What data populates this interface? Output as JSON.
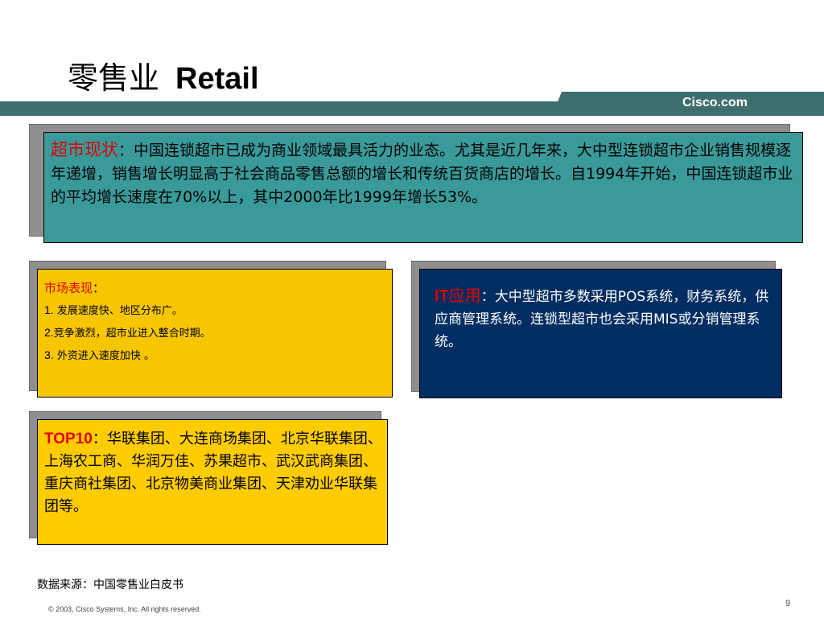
{
  "slide": {
    "title_cn": "零售业",
    "title_en": "Retail",
    "brand": "Cisco.com",
    "page_number": "9",
    "copyright": "© 2003, Cisco Systems, Inc. All rights reserved.",
    "source_note": "数据来源：中国零售业白皮书"
  },
  "box_status": {
    "label": "超市现状",
    "colon": "：",
    "text": "中国连锁超市已成为商业领域最具活力的业态。尤其是近几年来，大中型连锁超市企业销售规模逐年递增，销售增长明显高于社会商品零售总额的增长和传统百货商店的增长。自1994年开始，中国连锁超市业的平均增长速度在70%以上，其中2000年比1999年增长53%。"
  },
  "box_market": {
    "label": "市场表现",
    "colon": "：",
    "items": [
      {
        "num": "1.",
        "text": "发展速度快、地区分布广。"
      },
      {
        "num": "2.",
        "text": "竞争激烈，超市业进入整合时期。"
      },
      {
        "num": "3.",
        "text": "外资进入速度加快 。"
      }
    ]
  },
  "box_it": {
    "label_it": "IT",
    "label_cn": "应用",
    "colon": "：",
    "text": "大中型超市多数采用POS系统，财务系统，供应商管理系统。连锁型超市也会采用MIS或分销管理系统。"
  },
  "box_top10": {
    "label": "TOP10",
    "colon": "：",
    "text": "华联集团、大连商场集团、北京华联集团、上海农工商、华润万佳、苏果超市、武汉武商集团、重庆商社集团、北京物美商业集团、天津劝业华联集团等。"
  },
  "colors": {
    "header_bar": "#3f6e6e",
    "teal_box": "#3a9a9a",
    "gold_box": "#f7c600",
    "navy_box": "#002d62",
    "yellow_box": "#ffcc00",
    "highlight_red": "#e00000"
  }
}
